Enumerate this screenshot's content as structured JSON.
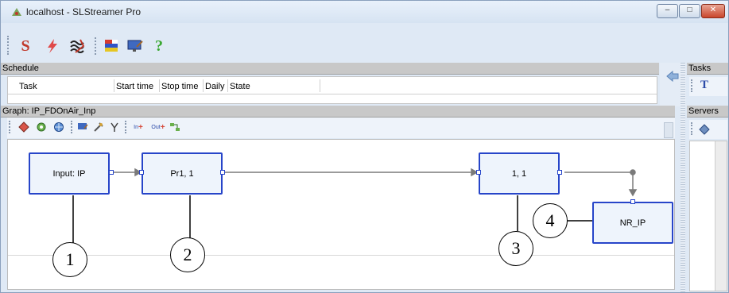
{
  "window": {
    "title": "localhost - SLStreamer Pro",
    "controls": [
      "–",
      "□",
      "✕"
    ]
  },
  "toolbar": {
    "icons": [
      "s-logo-icon",
      "lightning-icon",
      "waves-icon",
      "flag-icon",
      "monitor-icon",
      "help-icon"
    ],
    "help_glyph": "?",
    "s_glyph": "S"
  },
  "schedule": {
    "header": "Schedule",
    "columns": [
      "Task",
      "Start time",
      "Stop time",
      "Daily",
      "State"
    ]
  },
  "graph": {
    "header": "Graph: IP_FDOnAir_Inp",
    "toolbar_text": {
      "in": "In",
      "out": "Out"
    },
    "nodes": [
      {
        "label": "Input: IP"
      },
      {
        "label": "Pr1, 1"
      },
      {
        "label": "1, 1"
      },
      {
        "label": "NR_IP"
      }
    ],
    "callouts": [
      "1",
      "2",
      "3",
      "4"
    ]
  },
  "side": {
    "tasks_header": "Tasks",
    "tasks_button": "T",
    "servers_header": "Servers"
  },
  "colors": {
    "node_border": "#2745c9",
    "node_fill": "#eef4fc",
    "header_bg": "#c8c8c8"
  }
}
